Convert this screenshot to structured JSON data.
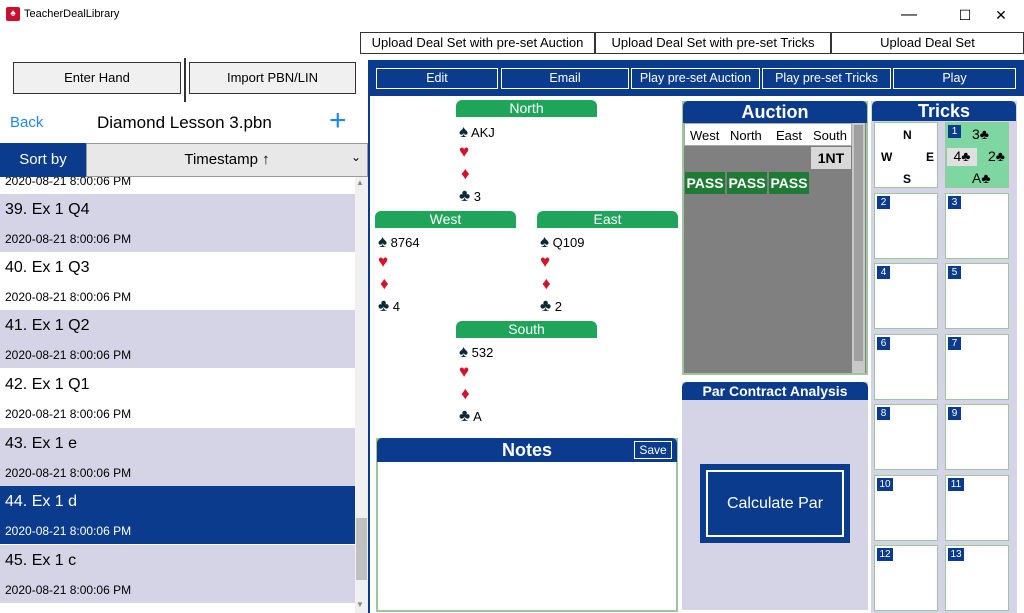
{
  "app": {
    "title": "TeacherDealLibrary",
    "minimize": "—",
    "maximize": "☐",
    "close": "✕"
  },
  "top_buttons": {
    "upload_auction": "Upload Deal Set with pre-set Auction",
    "upload_tricks": "Upload Deal Set with pre-set Tricks",
    "upload": "Upload Deal Set"
  },
  "left_buttons": {
    "enter_hand": "Enter Hand",
    "import": "Import PBN/LIN"
  },
  "toolbar": {
    "edit": "Edit",
    "email": "Email",
    "play_auction": "Play pre-set Auction",
    "play_tricks": "Play pre-set Tricks",
    "play": "Play"
  },
  "file_panel": {
    "back": "Back",
    "filename": "Diamond Lesson 3.pbn",
    "add": "+"
  },
  "sort": {
    "label": "Sort by",
    "value": "Timestamp ↑",
    "chevron": "⌄"
  },
  "list": {
    "top_ts": "2020-08-21 8:00:06 PM",
    "items": [
      {
        "name": "39. Ex 1 Q4",
        "ts": "2020-08-21 8:00:06 PM"
      },
      {
        "name": "40. Ex 1 Q3",
        "ts": "2020-08-21 8:00:06 PM"
      },
      {
        "name": "41. Ex 1 Q2",
        "ts": "2020-08-21 8:00:06 PM"
      },
      {
        "name": "42. Ex 1 Q1",
        "ts": "2020-08-21 8:00:06 PM"
      },
      {
        "name": "43. Ex 1 e",
        "ts": "2020-08-21 8:00:06 PM"
      },
      {
        "name": "44. Ex 1 d",
        "ts": "2020-08-21 8:00:06 PM"
      },
      {
        "name": "45. Ex 1 c",
        "ts": "2020-08-21 8:00:06 PM"
      }
    ],
    "selected_index": 5,
    "scroll_up": "▲",
    "scroll_down": "▼"
  },
  "hands": {
    "north": {
      "label": "North",
      "spades": "AKJ",
      "hearts": "",
      "diamonds": "",
      "clubs": "3"
    },
    "west": {
      "label": "West",
      "spades": "8764",
      "hearts": "",
      "diamonds": "",
      "clubs": "4"
    },
    "east": {
      "label": "East",
      "spades": "Q109",
      "hearts": "",
      "diamonds": "",
      "clubs": "2"
    },
    "south": {
      "label": "South",
      "spades": "532",
      "hearts": "",
      "diamonds": "",
      "clubs": "A"
    }
  },
  "suits": {
    "spade": "♠",
    "heart": "♥",
    "diamond": "♦",
    "club": "♣"
  },
  "notes": {
    "title": "Notes",
    "save": "Save",
    "text": ""
  },
  "auction": {
    "title": "Auction",
    "cols": [
      "West",
      "North",
      "East",
      "South"
    ],
    "bid_1nt": "1NT",
    "passes": [
      "PASS",
      "PASS",
      "PASS"
    ]
  },
  "par": {
    "title": "Par Contract Analysis",
    "button": "Calculate Par"
  },
  "tricks": {
    "title": "Tricks",
    "compass": {
      "n": "N",
      "w": "W",
      "e": "E",
      "s": "S"
    },
    "trick1": {
      "num": "1",
      "north": "3♣",
      "west": "4♣",
      "east": "2♣",
      "south": "A♣"
    },
    "numbers": [
      "2",
      "3",
      "4",
      "5",
      "6",
      "7",
      "8",
      "9",
      "10",
      "11",
      "12",
      "13"
    ]
  },
  "colors": {
    "blue": "#0a3b8c",
    "green": "#1fa55a",
    "list_alt": "#d4d4e6",
    "red": "#d6112e",
    "navy": "#0a2a3a"
  }
}
